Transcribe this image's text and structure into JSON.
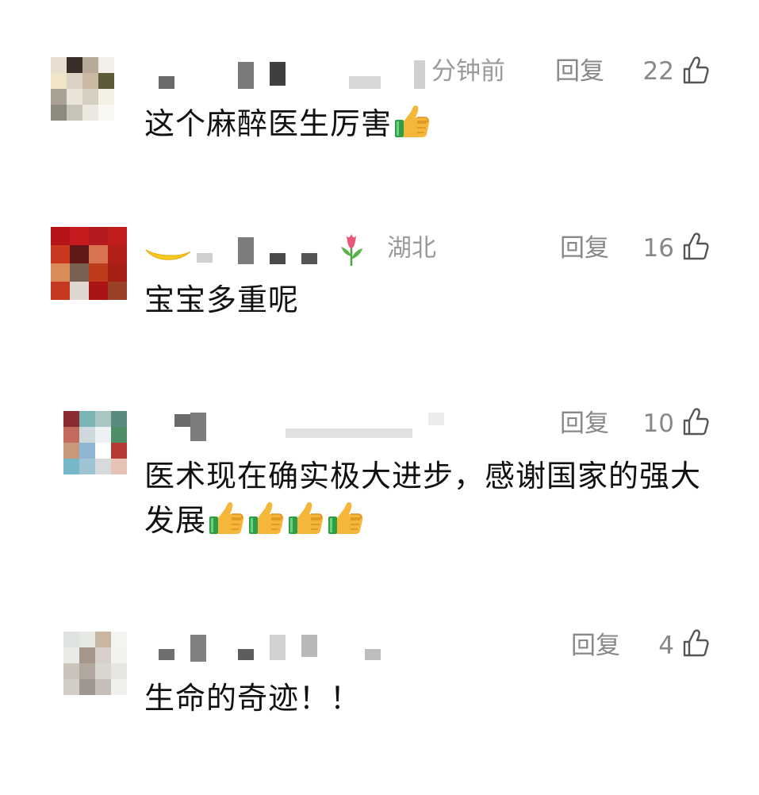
{
  "reply_label": "回复",
  "colors": {
    "meta": "#9b9b9b",
    "text": "#111111",
    "thumb_yellow": "#f5b73a",
    "thumb_cuff": "#2e9e46"
  },
  "icons": {
    "like": "thumbs-up-outline-icon",
    "emoji": "thumbs-up-emoji-icon"
  },
  "comments": [
    {
      "meta": "分钟前",
      "likes": "22",
      "text": "这个麻醉医生厉害",
      "emoji_count": 1
    },
    {
      "meta": "湖北",
      "likes": "16",
      "text": "宝宝多重呢",
      "emoji_count": 0
    },
    {
      "meta": "",
      "likes": "10",
      "text": "医术现在确实极大进步，感谢国家的强大发展",
      "emoji_count": 4
    },
    {
      "meta": "",
      "likes": "4",
      "text": "生命的奇迹！！",
      "emoji_count": 0
    }
  ]
}
